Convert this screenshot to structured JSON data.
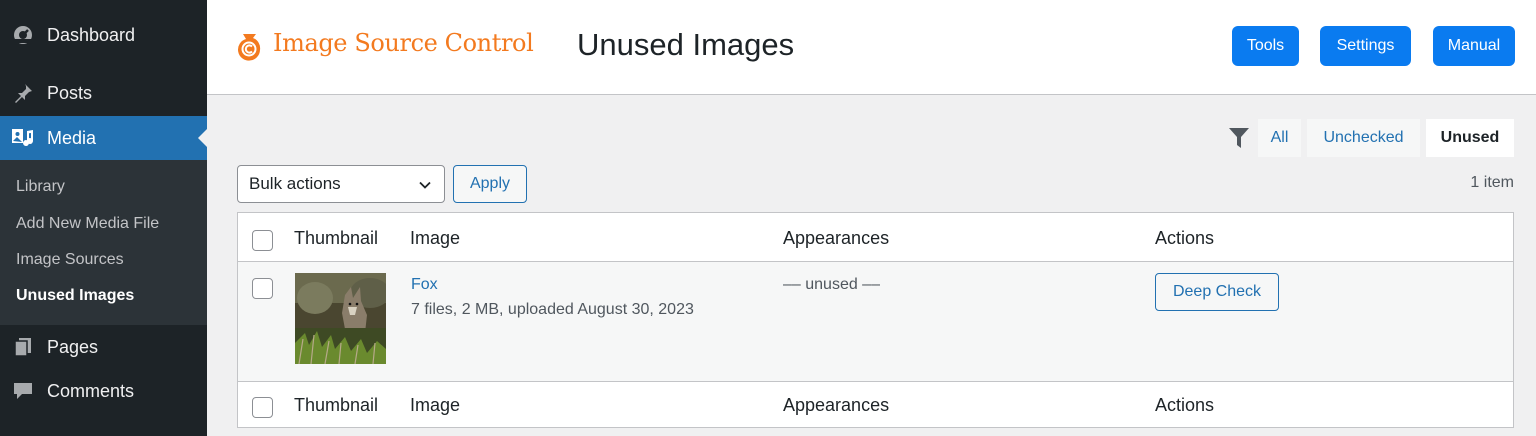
{
  "sidebar": {
    "items": [
      {
        "label": "Dashboard",
        "icon": "dashboard-icon"
      },
      {
        "label": "Posts",
        "icon": "pushpin-icon"
      },
      {
        "label": "Media",
        "icon": "media-icon"
      },
      {
        "label": "Pages",
        "icon": "pages-icon"
      },
      {
        "label": "Comments",
        "icon": "comment-icon"
      }
    ],
    "submenu": [
      {
        "label": "Library"
      },
      {
        "label": "Add New Media File"
      },
      {
        "label": "Image Sources"
      },
      {
        "label": "Unused Images"
      }
    ]
  },
  "header": {
    "brand": "Image Source Control",
    "title": "Unused Images",
    "buttons": {
      "tools": "Tools",
      "settings": "Settings",
      "manual": "Manual"
    }
  },
  "filters": {
    "tabs": [
      "All",
      "Unchecked",
      "Unused"
    ],
    "active": "Unused"
  },
  "bulk": {
    "select_value": "Bulk actions",
    "apply": "Apply",
    "count": "1 item"
  },
  "table": {
    "columns": [
      "Thumbnail",
      "Image",
      "Appearances",
      "Actions"
    ],
    "rows": [
      {
        "title": "Fox",
        "meta": "7 files, 2 MB, uploaded August 30, 2023",
        "appearances": "–– unused ––",
        "action": "Deep Check"
      }
    ]
  },
  "colors": {
    "accent": "#2271b1",
    "brand_orange": "#f37a1f",
    "header_button": "#0a7bf0",
    "sidebar_bg": "#1d2327"
  }
}
